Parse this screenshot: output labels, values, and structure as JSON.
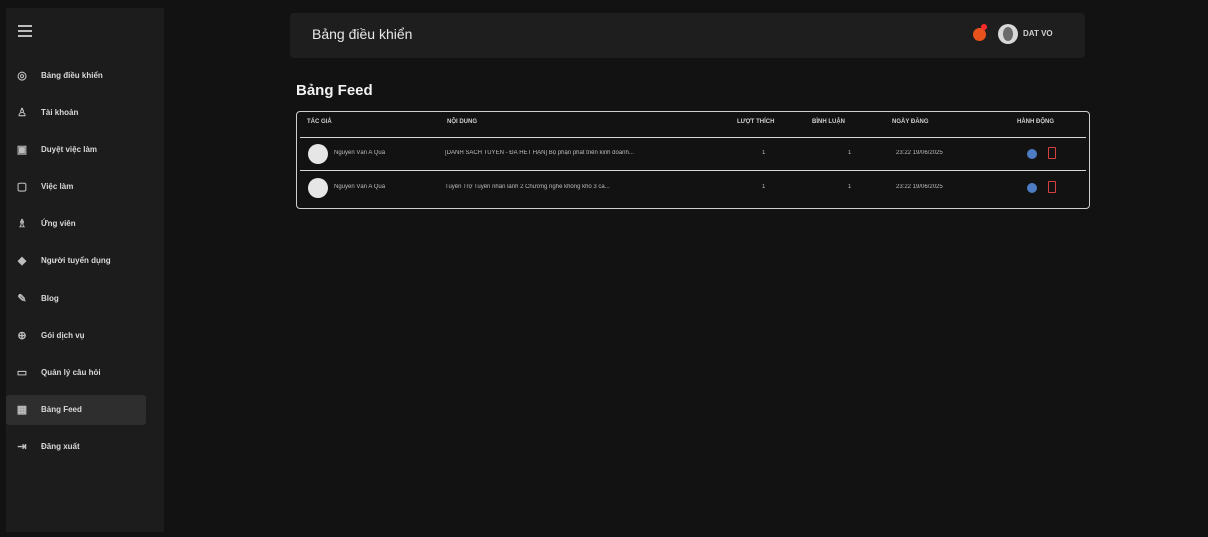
{
  "sidebar": {
    "items": [
      {
        "label": "Bảng điều khiển",
        "icon": "dashboard-icon"
      },
      {
        "label": "Tài khoản",
        "icon": "user-icon"
      },
      {
        "label": "Duyệt việc làm",
        "icon": "approve-icon"
      },
      {
        "label": "Việc làm",
        "icon": "briefcase-icon"
      },
      {
        "label": "Ứng viên",
        "icon": "people-icon"
      },
      {
        "label": "Người tuyển dụng",
        "icon": "recruiter-icon"
      },
      {
        "label": "Blog",
        "icon": "blog-icon"
      },
      {
        "label": "Gói dịch vụ",
        "icon": "package-icon"
      },
      {
        "label": "Quản lý câu hỏi",
        "icon": "chat-icon"
      },
      {
        "label": "Bảng Feed",
        "icon": "feed-icon",
        "active": true
      },
      {
        "label": "Đăng xuất",
        "icon": "logout-icon"
      }
    ]
  },
  "header": {
    "title": "Bảng điều khiển",
    "username": "DAT VO"
  },
  "page": {
    "title": "Bảng Feed"
  },
  "table": {
    "columns": [
      "TÁC GIẢ",
      "NỘI DUNG",
      "LƯỢT THÍCH",
      "BÌNH LUẬN",
      "NGÀY ĐĂNG",
      "HÀNH ĐỘNG"
    ],
    "rows": [
      {
        "author": "Nguyễn Văn A Quá",
        "content": "[DANH SÁCH TUYỂN - ĐÃ HẾT HẠN] Bộ phận phát triển kinh doanh...",
        "likes": "1",
        "comments": "1",
        "date": "23:22 19/06/2025"
      },
      {
        "author": "Nguyễn Văn A Quá",
        "content": "Tuyển Trợ Tuyển nhân lành 2 Chương nghề không khó 3 ca...",
        "likes": "1",
        "comments": "1",
        "date": "23:22 19/06/2025"
      }
    ]
  },
  "colors": {
    "background": "#121212",
    "sidebar": "#1c1c1c",
    "notification": "#e8521c",
    "view_action": "#4d7cc2",
    "delete_action": "#d64040"
  }
}
